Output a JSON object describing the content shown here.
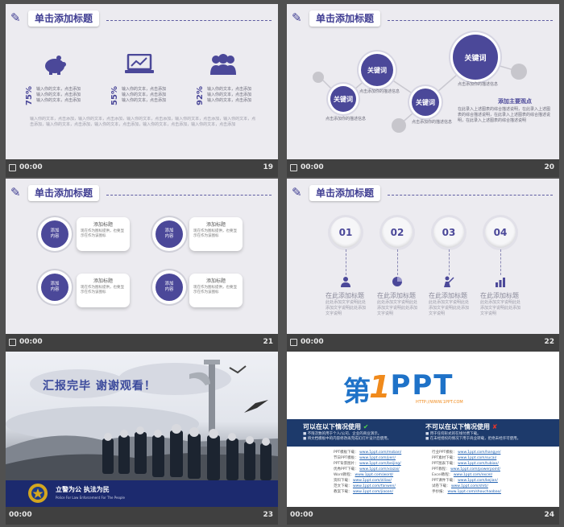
{
  "slides": [
    {
      "time": "00:00",
      "number": "19",
      "title": "单击添加标题",
      "stats": [
        {
          "pct": "75%",
          "icon": "piggy-bank-icon"
        },
        {
          "pct": "55%",
          "icon": "laptop-chart-icon"
        },
        {
          "pct": "92%",
          "icon": "people-icon"
        }
      ],
      "line": "输入你的文本，点击添加"
    },
    {
      "time": "00:00",
      "number": "20",
      "keywords": [
        "关键词",
        "关键词",
        "关键词",
        "关键词"
      ],
      "caption": "点击添加你的描述信息",
      "subtitle": "添加主要观点",
      "body": "在此录入上述图表的综合描述说明，在此录入上述图表的综合描述说明，在此录入上述图表的综合描述说明，在此录入上述图表的综合描述说明"
    },
    {
      "time": "00:00",
      "number": "21",
      "title": "单击添加标题",
      "items": [
        {
          "circle": "添加\n内容",
          "card_title": "添加标题",
          "card_body": "现在作为图标提供，也要显示在作为该图标"
        },
        {
          "circle": "添加\n内容",
          "card_title": "添加标题",
          "card_body": "现在作为图标提供，也要显示在作为该图标"
        },
        {
          "circle": "添加\n内容",
          "card_title": "添加标题",
          "card_body": "现在作为图标提供，也要显示在作为该图标"
        },
        {
          "circle": "添加\n内容",
          "card_title": "添加标题",
          "card_body": "现在作为图标提供，也要显示在作为该图标"
        }
      ]
    },
    {
      "time": "00:00",
      "number": "22",
      "title": "单击添加标题",
      "steps": [
        {
          "num": "01",
          "label": "在此添加标题",
          "icon": "user-icon"
        },
        {
          "num": "02",
          "label": "在此添加标题",
          "icon": "pie-icon"
        },
        {
          "num": "03",
          "label": "在此添加标题",
          "icon": "presenter-icon"
        },
        {
          "num": "04",
          "label": "在此添加标题",
          "icon": "bar-chart-icon"
        }
      ],
      "step_body": "此处添加文字说明此处添加文字说明此处添加文字说明"
    },
    {
      "time": "00:00",
      "number": "23",
      "headline": "汇报完毕 谢谢观看！",
      "motto": "立警为公 执法为民",
      "motto_en": "Police For Law Enforcement For The People"
    },
    {
      "time": "00:00",
      "number": "24",
      "logo_first": "第",
      "logo_one": "1",
      "logo_ppt": "PPT",
      "logo_url": "HTTP://WWW.1PPT.COM",
      "can_use": "可以在以下情况使用",
      "cannot_use": "不可以在以下情况使用",
      "can_items": [
        "不限次数的用于个人/公司、企业的商业演示。",
        "将文档模板中的内容修改再完成幻灯片设计后使用。"
      ],
      "cannot_items": [
        "用于任何形式的在线付费下载。",
        "在未经授权的情况下用于商业转载，拒绝未经许可使用。"
      ],
      "left_links": [
        [
          "PPT模板下载：",
          "www.1ppt.com/moban/"
        ],
        [
          "节日PPT模板：",
          "www.1ppt.com/jieri/"
        ],
        [
          "PPT背景图片：",
          "www.1ppt.com/beijing/"
        ],
        [
          "优秀PPT下载：",
          "www.1ppt.com/xiazai/"
        ],
        [
          "Word教程：",
          "www.1ppt.com/word/"
        ],
        [
          "资料下载：",
          "www.1ppt.com/ziliao/"
        ],
        [
          "范文下载：",
          "www.1ppt.com/fanwen/"
        ],
        [
          "教案下载：",
          "www.1ppt.com/jiaoan/"
        ]
      ],
      "right_links": [
        [
          "行业PPT模板：",
          "www.1ppt.com/hangye/"
        ],
        [
          "PPT素材下载：",
          "www.1ppt.com/sucai/"
        ],
        [
          "PPT图表下载：",
          "www.1ppt.com/tubiao/"
        ],
        [
          "PPT教程：",
          "www.1ppt.com/powerpoint/"
        ],
        [
          "Excel教程：",
          "www.1ppt.com/excel/"
        ],
        [
          "PPT课件下载：",
          "www.1ppt.com/kejian/"
        ],
        [
          "试卷下载：",
          "www.1ppt.com/shiti/"
        ],
        [
          "手抄报：",
          "www.1ppt.com/shouchaobao/"
        ]
      ]
    }
  ],
  "colors": {
    "accent": "#4b4899",
    "bar": "#404040",
    "ppt_blue": "#1e72c8",
    "ppt_orange": "#f08a1c",
    "navy": "#1d3a6b"
  }
}
